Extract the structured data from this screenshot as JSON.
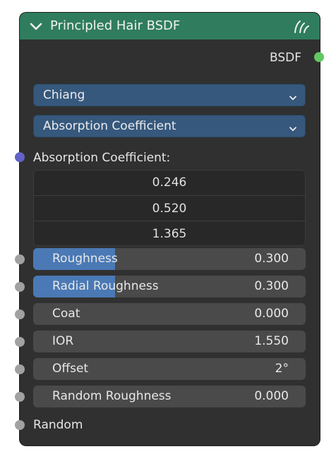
{
  "node": {
    "title": "Principled Hair BSDF",
    "header_color": "#2f7d5e",
    "output_label": "BSDF",
    "output_socket_color": "#63c763",
    "header_icon": "hair-curves-icon"
  },
  "dropdowns": {
    "model": "Chiang",
    "parametrization": "Absorption Coefficient"
  },
  "absorption": {
    "label": "Absorption Coefficient:",
    "socket_color": "#6363c7",
    "values": [
      "0.246",
      "0.520",
      "1.365"
    ]
  },
  "fields": [
    {
      "label": "Roughness",
      "value": "0.300",
      "fraction": 0.3
    },
    {
      "label": "Radial Roughness",
      "value": "0.300",
      "fraction": 0.3
    },
    {
      "label": "Coat",
      "value": "0.000"
    },
    {
      "label": "IOR",
      "value": "1.550"
    },
    {
      "label": "Offset",
      "value": "2°"
    },
    {
      "label": "Random Roughness",
      "value": "0.000"
    }
  ],
  "random": {
    "label": "Random",
    "socket_color": "#a1a1a1"
  },
  "colors": {
    "node_bg": "#303030",
    "dropdown_bg": "#36587d",
    "field_bg": "#4a4a4a",
    "slider_fill": "#4a79b5",
    "value_socket": "#a1a1a1"
  }
}
